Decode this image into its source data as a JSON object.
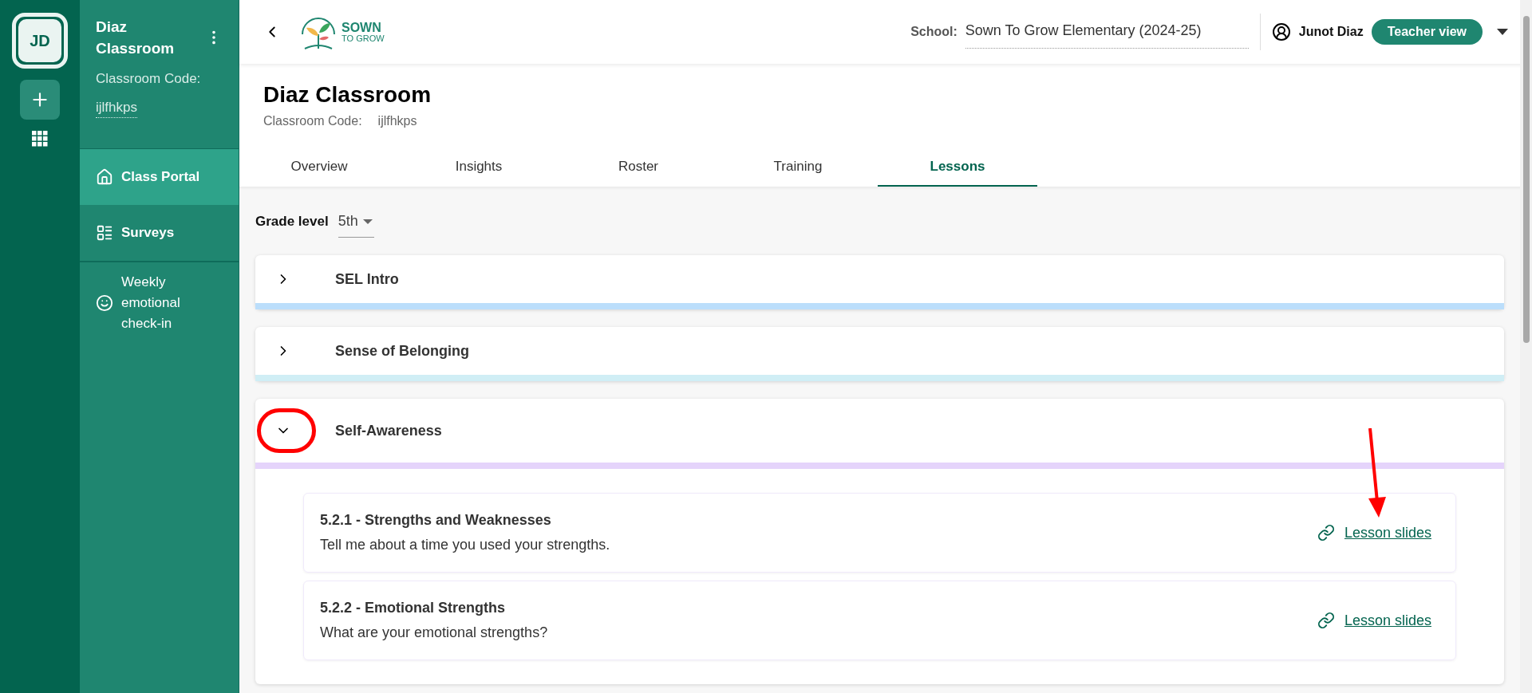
{
  "rail": {
    "avatar": "JD"
  },
  "sidebar": {
    "title": "Diaz Classroom",
    "code_label": "Classroom Code:",
    "code": "ijlfhkps",
    "items": [
      {
        "label": "Class Portal",
        "selected": true
      },
      {
        "label": "Surveys",
        "selected": false
      },
      {
        "label": "Weekly emotional check-in",
        "selected": false
      }
    ]
  },
  "header": {
    "logo_top": "SOWN",
    "logo_bottom": "TO GROW",
    "school_label": "School:",
    "school": "Sown To Grow Elementary (2024-25)",
    "user": "Junot Diaz",
    "view": "Teacher view"
  },
  "page": {
    "title": "Diaz Classroom",
    "code_label": "Classroom Code:",
    "code": "ijlfhkps"
  },
  "tabs": [
    {
      "label": "Overview",
      "selected": false
    },
    {
      "label": "Insights",
      "selected": false
    },
    {
      "label": "Roster",
      "selected": false
    },
    {
      "label": "Training",
      "selected": false
    },
    {
      "label": "Lessons",
      "selected": true
    }
  ],
  "grade": {
    "label": "Grade level",
    "value": "5th"
  },
  "sections": [
    {
      "title": "SEL Intro",
      "expanded": false,
      "color": "#bbdefb",
      "marked": false
    },
    {
      "title": "Sense of Belonging",
      "expanded": false,
      "color": "#d0eef5",
      "marked": false
    },
    {
      "title": "Self-Awareness",
      "expanded": true,
      "color": "#e5d4fb",
      "marked": true,
      "lessons": [
        {
          "title": "5.2.1 - Strengths and Weaknesses",
          "prompt": "Tell me about a time you used your strengths.",
          "link": "Lesson slides",
          "marked": true
        },
        {
          "title": "5.2.2 - Emotional Strengths",
          "prompt": "What are your emotional strengths?",
          "link": "Lesson slides",
          "marked": false
        }
      ]
    }
  ]
}
